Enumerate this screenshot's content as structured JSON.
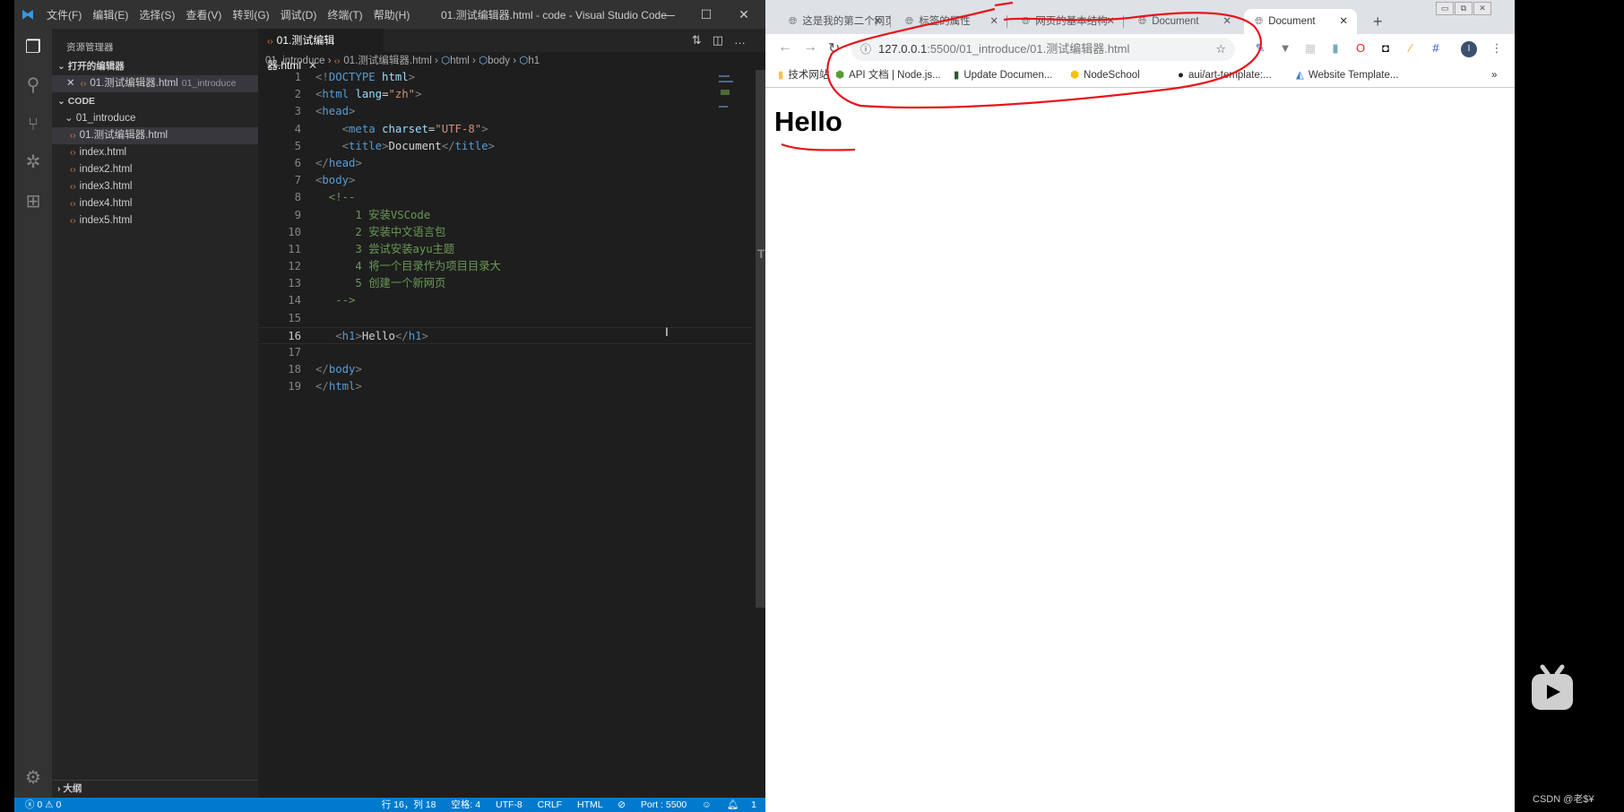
{
  "vscode": {
    "window_title": "01.测试编辑器.html - code - Visual Studio Code",
    "menu": [
      "文件(F)",
      "编辑(E)",
      "选择(S)",
      "查看(V)",
      "转到(G)",
      "调试(D)",
      "终端(T)",
      "帮助(H)"
    ],
    "sidebar": {
      "title": "资源管理器",
      "open_editors_label": "打开的编辑器",
      "open_editor": {
        "name": "01.测试编辑器.html",
        "folder": "01_introduce"
      },
      "workspace_label": "CODE",
      "folder": "01_introduce",
      "files": [
        "01.测试编辑器.html",
        "index.html",
        "index2.html",
        "index3.html",
        "index4.html",
        "index5.html"
      ],
      "outline_label": "大纲"
    },
    "tab": {
      "label": "01.测试编辑器.html"
    },
    "breadcrumbs": [
      "01_introduce",
      "01.测试编辑器.html",
      "html",
      "body",
      "h1"
    ],
    "code_lines": [
      [
        [
          "<!",
          "t-p"
        ],
        [
          "DOCTYPE ",
          "t-tag"
        ],
        [
          "html",
          "t-attr"
        ],
        [
          ">",
          "t-p"
        ]
      ],
      [
        [
          "<",
          "t-p"
        ],
        [
          "html ",
          "t-tag"
        ],
        [
          "lang",
          "t-attr"
        ],
        [
          "=",
          "t-txt"
        ],
        [
          "\"zh\"",
          "t-str"
        ],
        [
          ">",
          "t-p"
        ]
      ],
      [
        [
          "<",
          "t-p"
        ],
        [
          "head",
          "t-tag"
        ],
        [
          ">",
          "t-p"
        ]
      ],
      [
        [
          "    <",
          "t-p"
        ],
        [
          "meta ",
          "t-tag"
        ],
        [
          "charset",
          "t-attr"
        ],
        [
          "=",
          "t-txt"
        ],
        [
          "\"UTF-8\"",
          "t-str"
        ],
        [
          ">",
          "t-p"
        ]
      ],
      [
        [
          "    <",
          "t-p"
        ],
        [
          "title",
          "t-tag"
        ],
        [
          ">",
          "t-p"
        ],
        [
          "Document",
          "t-txt"
        ],
        [
          "</",
          "t-p"
        ],
        [
          "title",
          "t-tag"
        ],
        [
          ">",
          "t-p"
        ]
      ],
      [
        [
          "</",
          "t-p"
        ],
        [
          "head",
          "t-tag"
        ],
        [
          ">",
          "t-p"
        ]
      ],
      [
        [
          "<",
          "t-p"
        ],
        [
          "body",
          "t-tag"
        ],
        [
          ">",
          "t-p"
        ]
      ],
      [
        [
          "  <!--",
          "t-com"
        ]
      ],
      [
        [
          "      1 安装VSCode",
          "t-com"
        ]
      ],
      [
        [
          "      2 安装中文语言包",
          "t-com"
        ]
      ],
      [
        [
          "      3 尝试安装ayu主题",
          "t-com"
        ]
      ],
      [
        [
          "      4 将一个目录作为项目目录大",
          "t-com"
        ]
      ],
      [
        [
          "      5 创建一个新网页",
          "t-com"
        ]
      ],
      [
        [
          "   -->",
          "t-com"
        ]
      ],
      [],
      [
        [
          "   <",
          "t-p"
        ],
        [
          "h1",
          "t-tag"
        ],
        [
          ">",
          "t-p"
        ],
        [
          "Hello",
          "t-txt"
        ],
        [
          "</",
          "t-p"
        ],
        [
          "h1",
          "t-tag"
        ],
        [
          ">",
          "t-p"
        ]
      ],
      [],
      [
        [
          "</",
          "t-p"
        ],
        [
          "body",
          "t-tag"
        ],
        [
          ">",
          "t-p"
        ]
      ],
      [
        [
          "</",
          "t-p"
        ],
        [
          "html",
          "t-tag"
        ],
        [
          ">",
          "t-p"
        ]
      ]
    ],
    "current_line": 16,
    "status": {
      "errors": "0",
      "warnings": "0",
      "position": "行 16，列 18",
      "spaces": "空格: 4",
      "encoding": "UTF-8",
      "eol": "CRLF",
      "language": "HTML",
      "port": "Port : 5500",
      "notifications": "1"
    }
  },
  "browser": {
    "tabs": [
      {
        "title": "这是我的第二个网页",
        "active": false
      },
      {
        "title": "标签的属性",
        "active": false
      },
      {
        "title": "网页的基本结构",
        "active": false
      },
      {
        "title": "Document",
        "active": false
      },
      {
        "title": "Document",
        "active": true
      }
    ],
    "url_host": "127.0.0.1",
    "url_path": ":5500/01_introduce/01.测试编辑器.html",
    "bookmarks": [
      "技术网站",
      "API 文档 | Node.js...",
      "Update Documen...",
      "NodeSchool",
      "aui/art-template:...",
      "Website Template..."
    ],
    "profile_initial": "I",
    "page_heading": "Hello"
  },
  "annotation_color": "#e8141c",
  "watermark": "CSDN @老$¥"
}
